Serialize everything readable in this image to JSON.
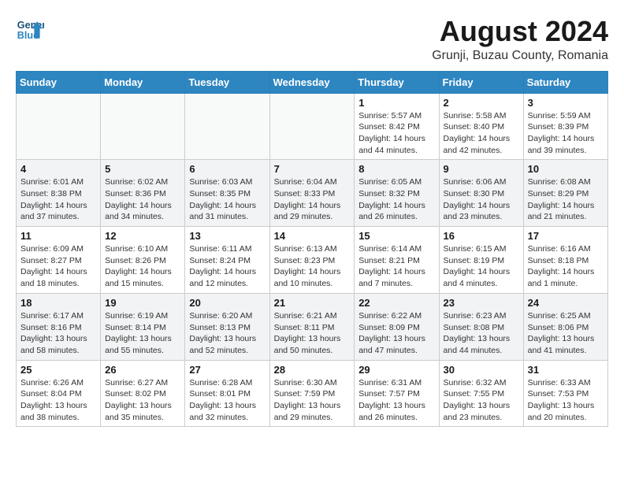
{
  "header": {
    "logo_line1": "General",
    "logo_line2": "Blue",
    "month_year": "August 2024",
    "location": "Grunji, Buzau County, Romania"
  },
  "days_of_week": [
    "Sunday",
    "Monday",
    "Tuesday",
    "Wednesday",
    "Thursday",
    "Friday",
    "Saturday"
  ],
  "weeks": [
    [
      {
        "day": "",
        "info": ""
      },
      {
        "day": "",
        "info": ""
      },
      {
        "day": "",
        "info": ""
      },
      {
        "day": "",
        "info": ""
      },
      {
        "day": "1",
        "info": "Sunrise: 5:57 AM\nSunset: 8:42 PM\nDaylight: 14 hours\nand 44 minutes."
      },
      {
        "day": "2",
        "info": "Sunrise: 5:58 AM\nSunset: 8:40 PM\nDaylight: 14 hours\nand 42 minutes."
      },
      {
        "day": "3",
        "info": "Sunrise: 5:59 AM\nSunset: 8:39 PM\nDaylight: 14 hours\nand 39 minutes."
      }
    ],
    [
      {
        "day": "4",
        "info": "Sunrise: 6:01 AM\nSunset: 8:38 PM\nDaylight: 14 hours\nand 37 minutes."
      },
      {
        "day": "5",
        "info": "Sunrise: 6:02 AM\nSunset: 8:36 PM\nDaylight: 14 hours\nand 34 minutes."
      },
      {
        "day": "6",
        "info": "Sunrise: 6:03 AM\nSunset: 8:35 PM\nDaylight: 14 hours\nand 31 minutes."
      },
      {
        "day": "7",
        "info": "Sunrise: 6:04 AM\nSunset: 8:33 PM\nDaylight: 14 hours\nand 29 minutes."
      },
      {
        "day": "8",
        "info": "Sunrise: 6:05 AM\nSunset: 8:32 PM\nDaylight: 14 hours\nand 26 minutes."
      },
      {
        "day": "9",
        "info": "Sunrise: 6:06 AM\nSunset: 8:30 PM\nDaylight: 14 hours\nand 23 minutes."
      },
      {
        "day": "10",
        "info": "Sunrise: 6:08 AM\nSunset: 8:29 PM\nDaylight: 14 hours\nand 21 minutes."
      }
    ],
    [
      {
        "day": "11",
        "info": "Sunrise: 6:09 AM\nSunset: 8:27 PM\nDaylight: 14 hours\nand 18 minutes."
      },
      {
        "day": "12",
        "info": "Sunrise: 6:10 AM\nSunset: 8:26 PM\nDaylight: 14 hours\nand 15 minutes."
      },
      {
        "day": "13",
        "info": "Sunrise: 6:11 AM\nSunset: 8:24 PM\nDaylight: 14 hours\nand 12 minutes."
      },
      {
        "day": "14",
        "info": "Sunrise: 6:13 AM\nSunset: 8:23 PM\nDaylight: 14 hours\nand 10 minutes."
      },
      {
        "day": "15",
        "info": "Sunrise: 6:14 AM\nSunset: 8:21 PM\nDaylight: 14 hours\nand 7 minutes."
      },
      {
        "day": "16",
        "info": "Sunrise: 6:15 AM\nSunset: 8:19 PM\nDaylight: 14 hours\nand 4 minutes."
      },
      {
        "day": "17",
        "info": "Sunrise: 6:16 AM\nSunset: 8:18 PM\nDaylight: 14 hours\nand 1 minute."
      }
    ],
    [
      {
        "day": "18",
        "info": "Sunrise: 6:17 AM\nSunset: 8:16 PM\nDaylight: 13 hours\nand 58 minutes."
      },
      {
        "day": "19",
        "info": "Sunrise: 6:19 AM\nSunset: 8:14 PM\nDaylight: 13 hours\nand 55 minutes."
      },
      {
        "day": "20",
        "info": "Sunrise: 6:20 AM\nSunset: 8:13 PM\nDaylight: 13 hours\nand 52 minutes."
      },
      {
        "day": "21",
        "info": "Sunrise: 6:21 AM\nSunset: 8:11 PM\nDaylight: 13 hours\nand 50 minutes."
      },
      {
        "day": "22",
        "info": "Sunrise: 6:22 AM\nSunset: 8:09 PM\nDaylight: 13 hours\nand 47 minutes."
      },
      {
        "day": "23",
        "info": "Sunrise: 6:23 AM\nSunset: 8:08 PM\nDaylight: 13 hours\nand 44 minutes."
      },
      {
        "day": "24",
        "info": "Sunrise: 6:25 AM\nSunset: 8:06 PM\nDaylight: 13 hours\nand 41 minutes."
      }
    ],
    [
      {
        "day": "25",
        "info": "Sunrise: 6:26 AM\nSunset: 8:04 PM\nDaylight: 13 hours\nand 38 minutes."
      },
      {
        "day": "26",
        "info": "Sunrise: 6:27 AM\nSunset: 8:02 PM\nDaylight: 13 hours\nand 35 minutes."
      },
      {
        "day": "27",
        "info": "Sunrise: 6:28 AM\nSunset: 8:01 PM\nDaylight: 13 hours\nand 32 minutes."
      },
      {
        "day": "28",
        "info": "Sunrise: 6:30 AM\nSunset: 7:59 PM\nDaylight: 13 hours\nand 29 minutes."
      },
      {
        "day": "29",
        "info": "Sunrise: 6:31 AM\nSunset: 7:57 PM\nDaylight: 13 hours\nand 26 minutes."
      },
      {
        "day": "30",
        "info": "Sunrise: 6:32 AM\nSunset: 7:55 PM\nDaylight: 13 hours\nand 23 minutes."
      },
      {
        "day": "31",
        "info": "Sunrise: 6:33 AM\nSunset: 7:53 PM\nDaylight: 13 hours\nand 20 minutes."
      }
    ]
  ]
}
